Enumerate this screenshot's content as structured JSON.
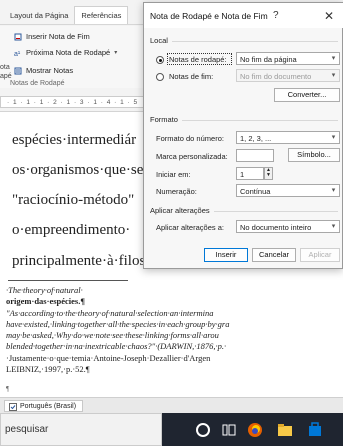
{
  "ribbon": {
    "tabs": [
      "Layout da Página",
      "Referências"
    ],
    "items": [
      "Inserir Nota de Fim",
      "Próxima Nota de Rodapé",
      "Mostrar Notas"
    ],
    "side_label_1": "ota",
    "side_label_2": "apé",
    "group_name": "Notas de Rodapé",
    "ruler": "· 1 · 1 · 1 · 2 · 1 · 3 · 1 · 4 · 1 · 5"
  },
  "document": {
    "lines": [
      "espécies·intermediár",
      "os·organismos·que·ser",
      "\"raciocínio-método\"",
      "o·empreendimento·",
      "principalmente·à·filos"
    ],
    "footnotes": {
      "fn1_a": "·The·theory·of·natural·",
      "fn1_b": "origem·das·espécies.¶",
      "fn2_a": "\"As·according·to·the·theory·of·natural·selection·an·intermina",
      "fn2_b": "have·existed,·linking·together·all·the·species·in·each·group·by·gra",
      "fn2_c": "may·be·asked,·Why·do·we·note·see·these·linking·forms·all·arou",
      "fn2_d": "blended·together·in·na·inextricable·chaos?\"·(DARWIN,·1876,·p.·",
      "fn3_a": "·Justamente·o·que·temia·Antoine-Joseph·Dezallier·d'Argen",
      "fn3_b": "LEIBNIZ,·1997,·p.·52.¶"
    },
    "pilcrow": "¶"
  },
  "status": {
    "language": "Português (Brasil)"
  },
  "taskbar": {
    "search_placeholder": "pesquisar"
  },
  "dialog": {
    "title": "Nota de Rodapé e Nota de Fim",
    "help": "?",
    "close": "✕",
    "local_label": "Local",
    "footnote_radio": "Notas de rodapé:",
    "footnote_value": "No fim da página",
    "endnote_radio": "Notas de fim:",
    "endnote_value": "No fim do documento",
    "convert_button": "Converter...",
    "format_label": "Formato",
    "number_format_label": "Formato do número:",
    "number_format_value": "1, 2, 3, ...",
    "custom_mark_label": "Marca personalizada:",
    "custom_mark_value": "",
    "symbol_button": "Símbolo...",
    "start_at_label": "Iniciar em:",
    "start_at_value": "1",
    "numbering_label": "Numeração:",
    "numbering_value": "Contínua",
    "apply_label": "Aplicar alterações",
    "apply_to_label": "Aplicar alterações a:",
    "apply_to_value": "No documento inteiro",
    "insert_button": "Inserir",
    "cancel_button": "Cancelar",
    "apply_button": "Aplicar"
  }
}
